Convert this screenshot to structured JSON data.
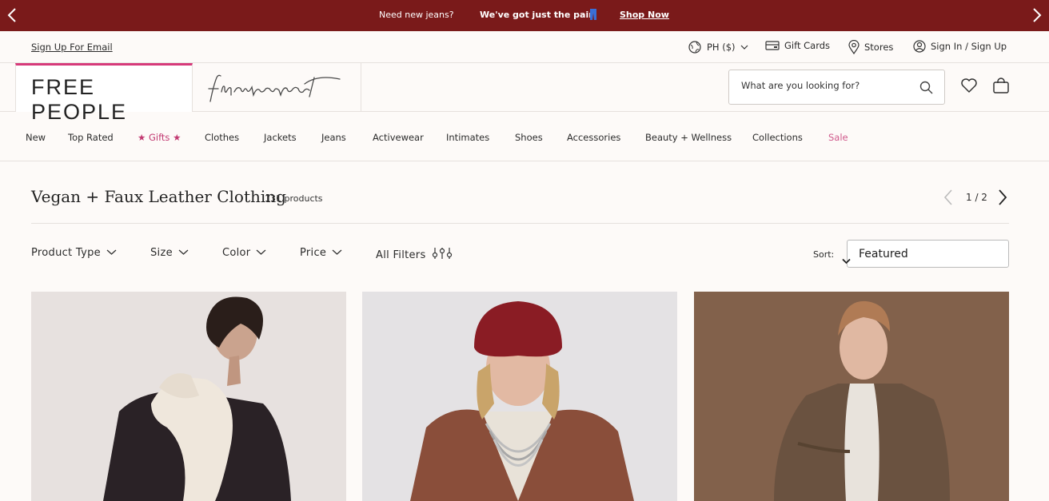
{
  "promo": {
    "message": "Need new jeans?",
    "highlight": "We've got just the pair",
    "cta": "Shop Now"
  },
  "utility": {
    "signup": "Sign Up For Email",
    "region": "PH ($)",
    "gift_cards": "Gift Cards",
    "stores": "Stores",
    "sign_in": "Sign In / Sign Up"
  },
  "brand": {
    "name": "FREE PEOPLE",
    "sub_brand_icon": "fp-movement-logo"
  },
  "search": {
    "placeholder": "What are you looking for?"
  },
  "nav": {
    "items": [
      "New",
      "Top Rated",
      "★ Gifts ★",
      "Clothes",
      "Jackets",
      "Jeans",
      "Activewear",
      "Intimates",
      "Shoes",
      "Accessories",
      "Beauty + Wellness",
      "Collections",
      "Sale"
    ]
  },
  "listing": {
    "title": "Vegan + Faux Leather Clothing",
    "count": "131 products",
    "page": "1 / 2"
  },
  "filters": {
    "product_type": "Product Type",
    "size": "Size",
    "color": "Color",
    "price": "Price",
    "all_filters": "All Filters",
    "sort_label": "Sort:",
    "sort_value": "Featured"
  },
  "colors": {
    "promo_bg": "#7a1a1a",
    "accent_pink": "#d63a7a",
    "sale": "#d05a8c"
  }
}
